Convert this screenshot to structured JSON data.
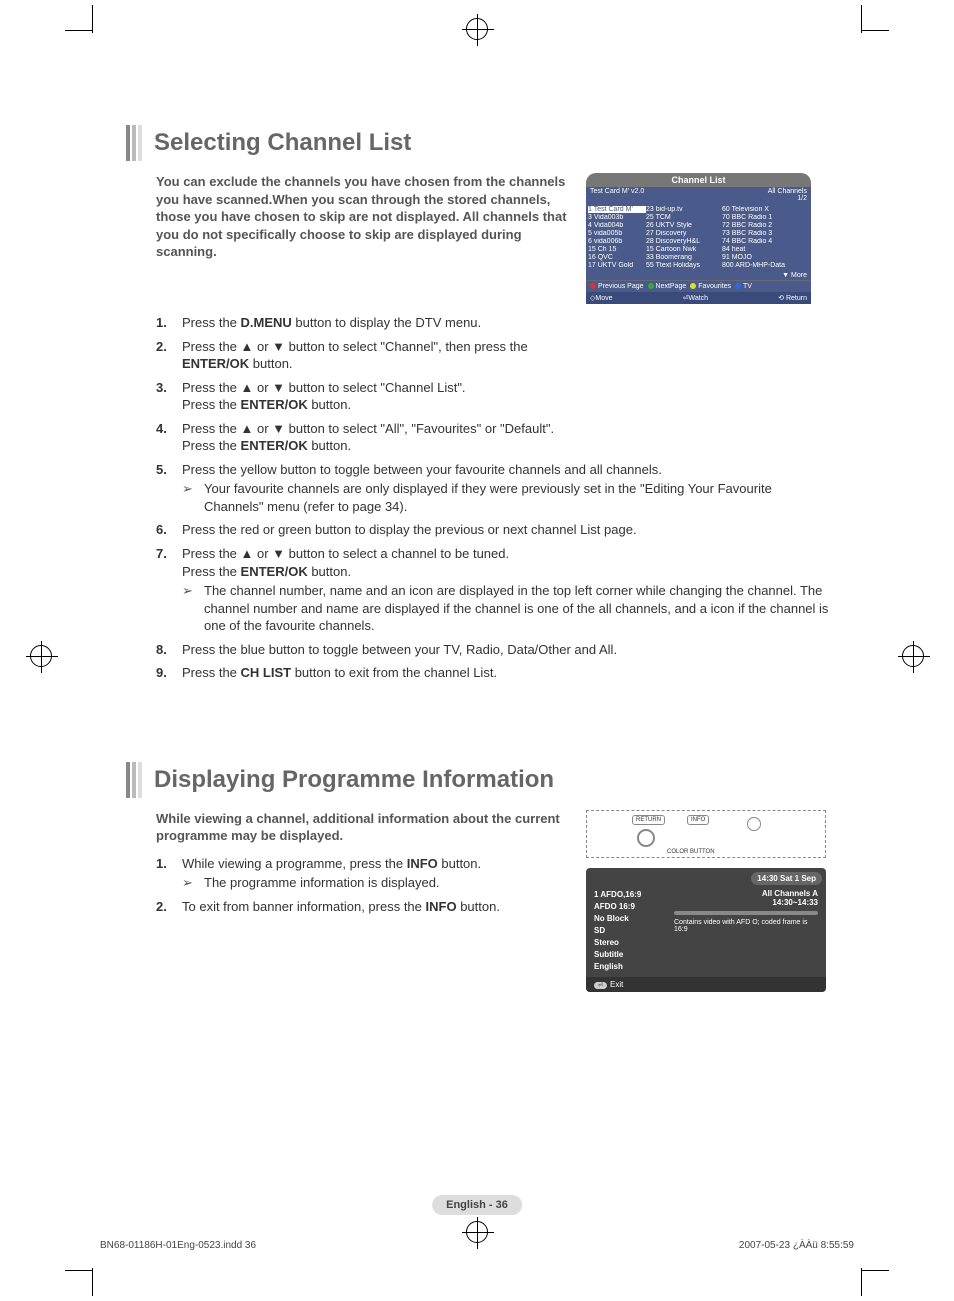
{
  "section1": {
    "title": "Selecting Channel List",
    "intro": "You can exclude the channels you have chosen from the channels you have scanned.When you scan through the stored channels, those you have chosen to skip are not displayed. All channels that you do not specifically choose to skip are displayed during scanning.",
    "steps": [
      {
        "n": "1.",
        "t": "Press the <b>D.MENU</b> button to display the DTV menu."
      },
      {
        "n": "2.",
        "t": "Press the ▲ or ▼ button to select \"Channel\", then press the <b>ENTER/OK</b> button."
      },
      {
        "n": "3.",
        "t": "Press the ▲ or ▼ button to select \"Channel List\".<br>Press the <b>ENTER/OK</b> button."
      },
      {
        "n": "4.",
        "t": "Press the ▲ or ▼ button to select \"All\", \"Favourites\" or \"Default\".<br>Press the <b>ENTER/OK</b> button."
      },
      {
        "n": "5.",
        "t": "Press the yellow button to toggle between your favourite channels and all channels.",
        "sub": "Your favourite channels are only displayed if they were previously set in the \"Editing Your Favourite Channels\" menu (refer to page 34)."
      },
      {
        "n": "6.",
        "t": "Press the red or green button to display the previous or next channel List page."
      },
      {
        "n": "7.",
        "t": "Press the ▲ or ▼ button to select a channel to be tuned.<br>Press the <b>ENTER/OK</b> button.",
        "sub": "The channel number, name and an icon are displayed in the top left corner while changing the channel. The channel number and name are displayed if the channel is one of the all channels, and a  icon if the channel is one of the favourite channels."
      },
      {
        "n": "8.",
        "t": "Press the blue button to toggle between your TV, Radio, Data/Other and All."
      },
      {
        "n": "9.",
        "t": "Press the <b>CH LIST</b> button to exit from the channel List."
      }
    ]
  },
  "channel_list": {
    "title": "Channel List",
    "sub_left": "Test Card M' v2.0",
    "sub_right_top": "All Channels",
    "sub_right_bot": "1/2",
    "rows": [
      {
        "c1": "1  Test Card M'",
        "c2": "23  bid-up.tv",
        "c3": "60  Television X",
        "hl": true
      },
      {
        "c1": "3  Vida003b",
        "c2": "25  TCM",
        "c3": "70  BBC Radio 1"
      },
      {
        "c1": "4  Vida004b",
        "c2": "26  UKTV Style",
        "c3": "72  BBC Radio 2"
      },
      {
        "c1": "5  vida005b",
        "c2": "27  Discovery",
        "c3": "73  BBC Radio 3"
      },
      {
        "c1": "6  vida006b",
        "c2": "28  DiscoveryH&L",
        "c3": "74  BBC Radio 4"
      },
      {
        "c1": "15  Ch 15",
        "c2": "15  Cartoon Nwk",
        "c3": "84  heat"
      },
      {
        "c1": "16  QVC",
        "c2": "33  Boomerang",
        "c3": "91  MOJO"
      },
      {
        "c1": "17  UKTV Gold",
        "c2": "55  Ttext Holidays",
        "c3": "800  ARD-MHP-Data"
      }
    ],
    "more": "▼ More",
    "foot1": {
      "red": "Previous Page",
      "green": "NextPage",
      "yellow": "Favourites",
      "blue": "TV"
    },
    "foot2": {
      "move": "Move",
      "watch": "Watch",
      "return": "Return"
    }
  },
  "section2": {
    "title": "Displaying Programme Information",
    "intro": "While viewing a channel, additional information about the current programme may be displayed.",
    "steps": [
      {
        "n": "1.",
        "t": "While viewing a programme, press the <b>INFO</b> button.",
        "sub": "The programme information is displayed."
      },
      {
        "n": "2.",
        "t": "To exit from banner information, press the <b>INFO</b> button."
      }
    ]
  },
  "remote": {
    "return": "RETURN",
    "info": "INFO",
    "color": "COLOR BUTTON"
  },
  "info_panel": {
    "time": "14:30 Sat 1 Sep",
    "col1": [
      "1 AFDO,16:9",
      "AFDO 16:9",
      "No Block",
      "SD",
      "Stereo",
      "Subtitle",
      "English"
    ],
    "all_channels": "All Channels    A",
    "time_range": "14:30~14:33",
    "desc": "Contains video with AFD O; coded frame is 16:9",
    "exit": "Exit"
  },
  "page_number": "English - 36",
  "footer_left": "BN68-01186H-01Eng-0523.indd   36",
  "footer_right": "2007-05-23   ¿ÀÀü 8:55:59"
}
